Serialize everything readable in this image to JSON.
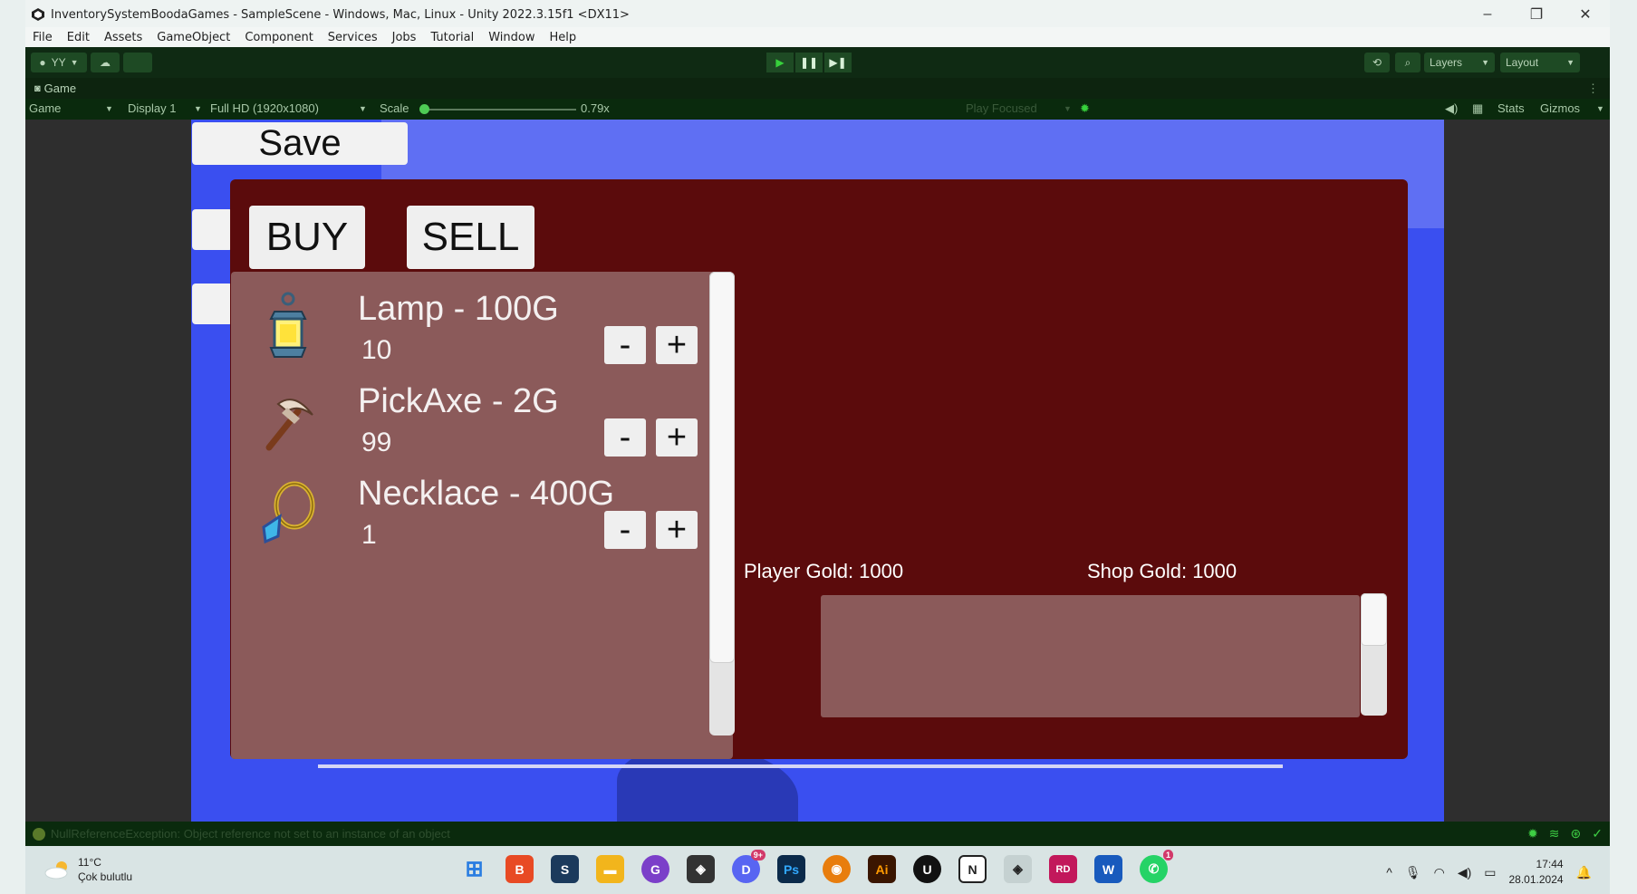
{
  "window": {
    "title": "InventorySystemBoodaGames - SampleScene - Windows, Mac, Linux - Unity 2022.3.15f1 <DX11>",
    "controls": [
      "–",
      "❐",
      "✕"
    ]
  },
  "menu": [
    "File",
    "Edit",
    "Assets",
    "GameObject",
    "Component",
    "Services",
    "Jobs",
    "Tutorial",
    "Window",
    "Help"
  ],
  "toolbar": {
    "account": "YY",
    "layers": "Layers",
    "layout": "Layout"
  },
  "game_tab": {
    "label": "Game"
  },
  "game_controls": {
    "view": "Game",
    "display": "Display 1",
    "resolution": "Full HD (1920x1080)",
    "scale_label": "Scale",
    "scale_value": "0.79x",
    "play_focused": "Play Focused",
    "stats": "Stats",
    "gizmos": "Gizmos"
  },
  "game": {
    "save_label": "Save",
    "buy_label": "BUY",
    "sell_label": "SELL",
    "items": [
      {
        "name": "Lamp - 100G",
        "qty": "10",
        "icon": "lamp-icon"
      },
      {
        "name": "PickAxe - 2G",
        "qty": "99",
        "icon": "pickaxe-icon"
      },
      {
        "name": "Necklace - 400G",
        "qty": "1",
        "icon": "necklace-icon"
      }
    ],
    "minus": "-",
    "plus": "+",
    "player_gold": "Player Gold: 1000",
    "shop_gold": "Shop Gold: 1000"
  },
  "status": {
    "message": "NullReferenceException: Object reference not set to an instance of an object"
  },
  "taskbar": {
    "temperature": "11°C",
    "weather": "Çok bulutlu",
    "time": "17:44",
    "date": "28.01.2024",
    "apps": [
      {
        "name": "windows-start-icon",
        "color": "#2a7de1",
        "text": "⊞",
        "badge": ""
      },
      {
        "name": "brave-icon",
        "color": "#e84a24",
        "text": "B",
        "badge": ""
      },
      {
        "name": "steam-icon",
        "color": "#1b3a5c",
        "text": "S",
        "badge": ""
      },
      {
        "name": "file-explorer-icon",
        "color": "#f2b51c",
        "text": "▬",
        "badge": ""
      },
      {
        "name": "github-icon",
        "color": "#7b3fc9",
        "text": "G",
        "badge": ""
      },
      {
        "name": "unity-hub-icon",
        "color": "#333333",
        "text": "◈",
        "badge": ""
      },
      {
        "name": "discord-icon",
        "color": "#5865f2",
        "text": "D",
        "badge": "9+"
      },
      {
        "name": "photoshop-icon",
        "color": "#0b2a4a",
        "text": "Ps",
        "badge": ""
      },
      {
        "name": "blender-icon",
        "color": "#e87d0d",
        "text": "◉",
        "badge": ""
      },
      {
        "name": "illustrator-icon",
        "color": "#3a1500",
        "text": "Ai",
        "badge": ""
      },
      {
        "name": "unreal-icon",
        "color": "#111111",
        "text": "U",
        "badge": ""
      },
      {
        "name": "notion-icon",
        "color": "#222222",
        "text": "N",
        "badge": ""
      },
      {
        "name": "unity-editor-icon",
        "color": "#333333",
        "text": "◈",
        "badge": ""
      },
      {
        "name": "rider-icon",
        "color": "#c2185b",
        "text": "RD",
        "badge": ""
      },
      {
        "name": "word-icon",
        "color": "#185abd",
        "text": "W",
        "badge": ""
      },
      {
        "name": "whatsapp-icon",
        "color": "#25d366",
        "text": "✆",
        "badge": "1"
      }
    ]
  }
}
